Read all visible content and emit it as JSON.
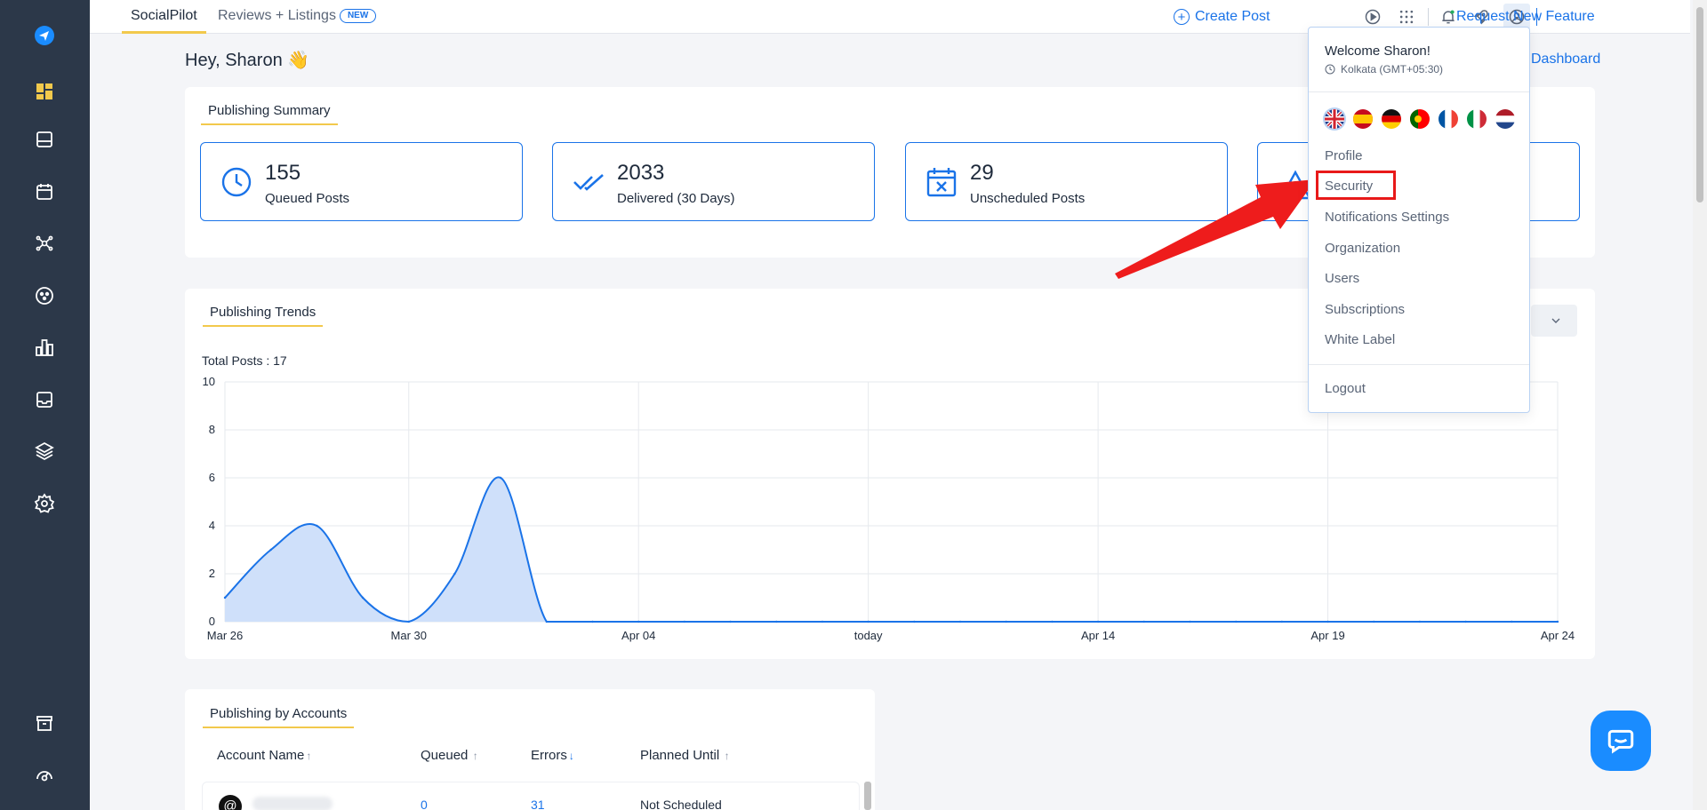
{
  "topbar": {
    "tabs": [
      {
        "label": "SocialPilot",
        "active": true
      },
      {
        "label": "Reviews + Listings",
        "badge": "NEW"
      }
    ],
    "create_post": "Create Post",
    "request_feature": "Request New Feature"
  },
  "sidebar": {
    "items": [
      {
        "icon": "logo-icon"
      },
      {
        "icon": "dashboard-icon",
        "active": true
      },
      {
        "icon": "posts-icon"
      },
      {
        "icon": "calendar-icon"
      },
      {
        "icon": "network-icon"
      },
      {
        "icon": "accounts-icon"
      },
      {
        "icon": "analytics-icon"
      },
      {
        "icon": "inbox-icon"
      },
      {
        "icon": "layers-icon"
      },
      {
        "icon": "settings-icon"
      },
      {
        "icon": "archive-icon"
      },
      {
        "icon": "support-icon"
      }
    ]
  },
  "main": {
    "greeting": "Hey, Sharon 👋",
    "dashboard_link": "Dashboard",
    "summary": {
      "title": "Publishing Summary",
      "stats": [
        {
          "value": "155",
          "label": "Queued Posts",
          "icon": "clock-icon"
        },
        {
          "value": "2033",
          "label": "Delivered (30 Days)",
          "icon": "double-check-icon"
        },
        {
          "value": "29",
          "label": "Unscheduled Posts",
          "icon": "calendar-x-icon"
        },
        {
          "value": "",
          "label": "",
          "icon": "warning-icon"
        }
      ]
    },
    "trends": {
      "title": "Publishing Trends",
      "total_posts": "Total Posts : 17"
    },
    "accounts": {
      "title": "Publishing by Accounts",
      "columns": [
        "Account Name",
        "Queued",
        "Errors",
        "Planned Until"
      ],
      "rows": [
        {
          "account": "",
          "queued": "0",
          "errors": "31",
          "planned_until": "Not Scheduled"
        }
      ]
    }
  },
  "chart_data": {
    "type": "area",
    "title": "",
    "xlabel": "",
    "ylabel": "",
    "ylim": [
      0,
      10
    ],
    "yticks": [
      "0",
      "2",
      "4",
      "6",
      "8",
      "10"
    ],
    "xticks": [
      "Mar 26",
      "Mar 30",
      "Apr 04",
      "today",
      "Apr 14",
      "Apr 19",
      "Apr 24"
    ],
    "x": [
      "Mar 26",
      "Mar 27",
      "Mar 28",
      "Mar 29",
      "Mar 30",
      "Mar 31",
      "Apr 01",
      "Apr 02",
      "Apr 03",
      "Apr 04",
      "Apr 05",
      "Apr 06",
      "Apr 07",
      "Apr 08",
      "Apr 09",
      "Apr 10",
      "Apr 11",
      "Apr 12",
      "Apr 13",
      "Apr 14",
      "Apr 15",
      "Apr 16",
      "Apr 17",
      "Apr 18",
      "Apr 19",
      "Apr 20",
      "Apr 21",
      "Apr 22",
      "Apr 23",
      "Apr 24"
    ],
    "series": [
      {
        "values": [
          1,
          3,
          4,
          1,
          0,
          2,
          6,
          0,
          0,
          0,
          0,
          0,
          0,
          0,
          0,
          0,
          0,
          0,
          0,
          0,
          0,
          0,
          0,
          0,
          0,
          0,
          0,
          0,
          0,
          0
        ]
      }
    ],
    "grid": true,
    "colors": {
      "line": "#1a73e8",
      "fill": "#cfe0fa"
    }
  },
  "dropdown": {
    "welcome": "Welcome Sharon!",
    "timezone": "Kolkata (GMT+05:30)",
    "languages": [
      "en",
      "es",
      "de",
      "pt",
      "fr",
      "it",
      "nl"
    ],
    "items": [
      "Profile",
      "Security",
      "Notifications Settings",
      "Organization",
      "Users",
      "Subscriptions",
      "White Label"
    ],
    "logout": "Logout"
  }
}
